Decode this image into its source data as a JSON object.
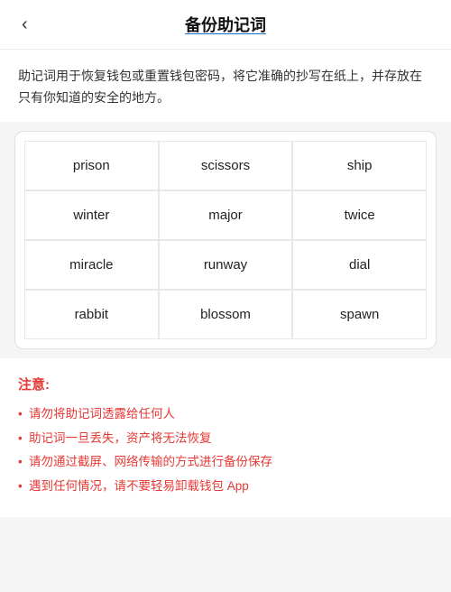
{
  "header": {
    "back_label": "‹",
    "title": "备份助记词"
  },
  "description": {
    "text": "助记词用于恢复钱包或重置钱包密码，将它准确的抄写在纸上，并存放在只有你知道的安全的地方。"
  },
  "mnemonic_words": [
    {
      "word": "prison"
    },
    {
      "word": "scissors"
    },
    {
      "word": "ship"
    },
    {
      "word": "winter"
    },
    {
      "word": "major"
    },
    {
      "word": "twice"
    },
    {
      "word": "miracle"
    },
    {
      "word": "runway"
    },
    {
      "word": "dial"
    },
    {
      "word": "rabbit"
    },
    {
      "word": "blossom"
    },
    {
      "word": "spawn"
    }
  ],
  "notice": {
    "title": "注意:",
    "items": [
      "请勿将助记词透露给任何人",
      "助记词一旦丢失，资产将无法恢复",
      "请勿通过截屏、网络传输的方式进行备份保存",
      "遇到任何情况，请不要轻易卸载钱包 App"
    ]
  }
}
